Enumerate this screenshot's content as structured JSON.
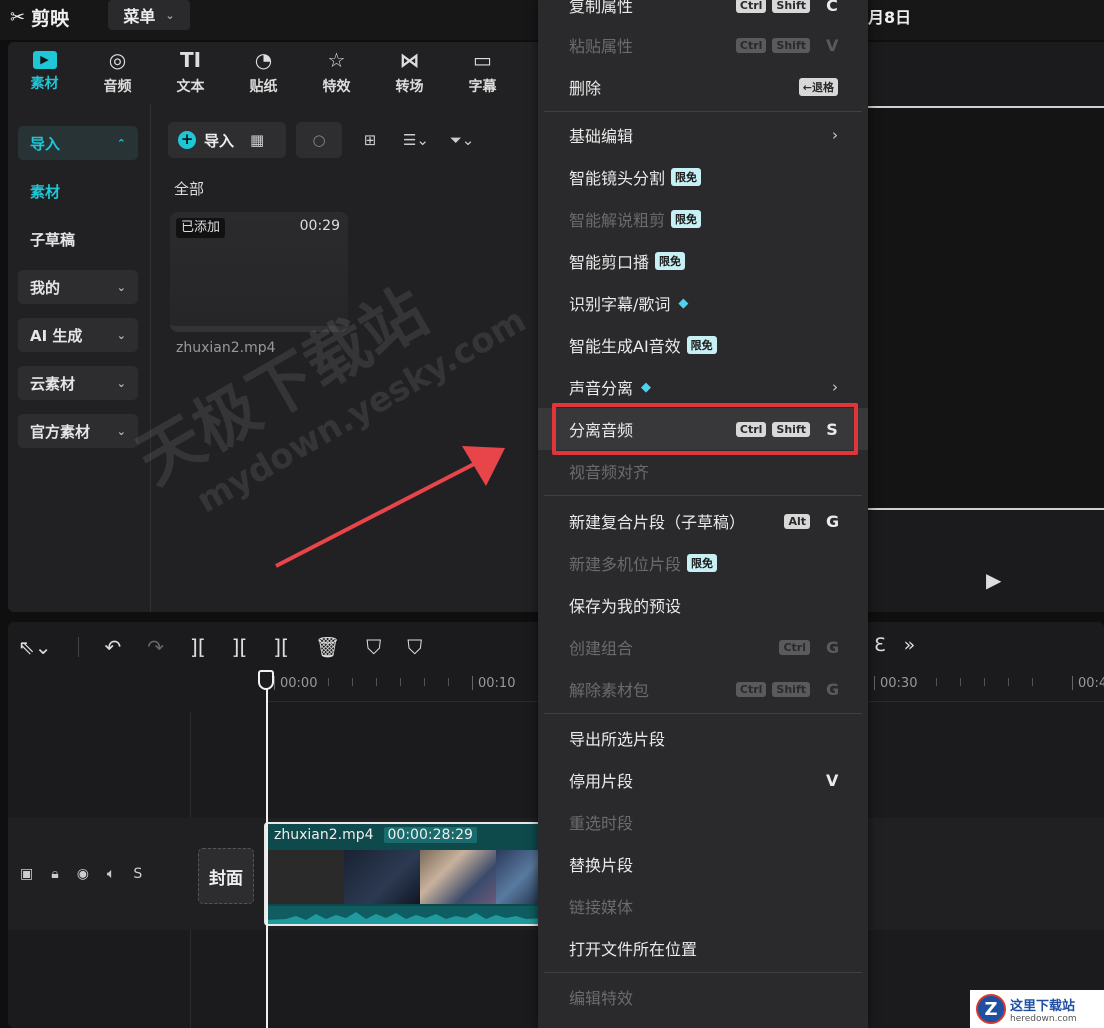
{
  "app": {
    "logo_text": "剪映",
    "menu_label": "菜单",
    "date_fragment": "月8日"
  },
  "tool_tabs": [
    {
      "label": "素材",
      "icon": "media-icon"
    },
    {
      "label": "音频",
      "icon": "audio-icon"
    },
    {
      "label": "文本",
      "icon": "text-icon",
      "glyph": "TI"
    },
    {
      "label": "贴纸",
      "icon": "sticker-icon"
    },
    {
      "label": "特效",
      "icon": "effects-icon"
    },
    {
      "label": "转场",
      "icon": "transition-icon"
    },
    {
      "label": "字幕",
      "icon": "subtitle-icon"
    }
  ],
  "side_nav": [
    {
      "label": "导入"
    },
    {
      "label": "素材"
    },
    {
      "label": "子草稿"
    },
    {
      "label": "我的"
    },
    {
      "label": "AI 生成"
    },
    {
      "label": "云素材"
    },
    {
      "label": "官方素材"
    }
  ],
  "media": {
    "import_label": "导入",
    "section_label": "全部",
    "clip_badge": "已添加",
    "clip_duration": "00:29",
    "clip_name": "zhuxian2.mp4"
  },
  "watermark": {
    "line1": "天极下载站",
    "line2": "mydown.yesky.com"
  },
  "context_menu": [
    {
      "label": "复制属性",
      "keys": [
        "Ctrl",
        "Shift"
      ],
      "key": "C",
      "disabled": false
    },
    {
      "label": "粘贴属性",
      "keys": [
        "Ctrl",
        "Shift"
      ],
      "key": "V",
      "disabled": true
    },
    {
      "label": "删除",
      "keys": [
        "←退格"
      ],
      "key": "",
      "disabled": false
    },
    {
      "label": "基础编辑",
      "submenu": true,
      "disabled": false
    },
    {
      "label": "智能镜头分割",
      "badge": "限免",
      "disabled": false
    },
    {
      "label": "智能解说粗剪",
      "badge": "限免",
      "disabled": true
    },
    {
      "label": "智能剪口播",
      "badge": "限免",
      "disabled": false
    },
    {
      "label": "识别字幕/歌词",
      "gem": true,
      "disabled": false
    },
    {
      "label": "智能生成AI音效",
      "badge": "限免",
      "disabled": false
    },
    {
      "label": "声音分离",
      "gem": true,
      "submenu": true,
      "disabled": false
    },
    {
      "label": "分离音频",
      "keys": [
        "Ctrl",
        "Shift"
      ],
      "key": "S",
      "disabled": false,
      "highlighted": true
    },
    {
      "label": "视音频对齐",
      "disabled": true
    },
    {
      "label": "新建复合片段（子草稿）",
      "keys": [
        "Alt"
      ],
      "key": "G",
      "disabled": false
    },
    {
      "label": "新建多机位片段",
      "badge": "限免",
      "disabled": true
    },
    {
      "label": "保存为我的预设",
      "disabled": false
    },
    {
      "label": "创建组合",
      "keys": [
        "Ctrl"
      ],
      "key": "G",
      "disabled": true
    },
    {
      "label": "解除素材包",
      "keys": [
        "Ctrl",
        "Shift"
      ],
      "key": "G",
      "disabled": true
    },
    {
      "label": "导出所选片段",
      "disabled": false
    },
    {
      "label": "停用片段",
      "key": "V",
      "disabled": false
    },
    {
      "label": "重选时段",
      "disabled": true
    },
    {
      "label": "替换片段",
      "disabled": false
    },
    {
      "label": "链接媒体",
      "disabled": true
    },
    {
      "label": "打开文件所在位置",
      "disabled": false
    },
    {
      "label": "编辑特效",
      "disabled": true
    }
  ],
  "timeline": {
    "ticks": [
      "00:00",
      "00:10",
      "00:30",
      "00:4"
    ],
    "track_mute_label": "S",
    "cover_label": "封面",
    "clip_name": "zhuxian2.mp4",
    "clip_duration": "00:00:28:29"
  },
  "corner_logo": {
    "cn": "这里下载站",
    "en": "heredown.com",
    "mark": "Z"
  },
  "colors": {
    "accent": "#1fc6d6",
    "highlight_border": "#e0353a",
    "arrow": "#e8454a"
  }
}
